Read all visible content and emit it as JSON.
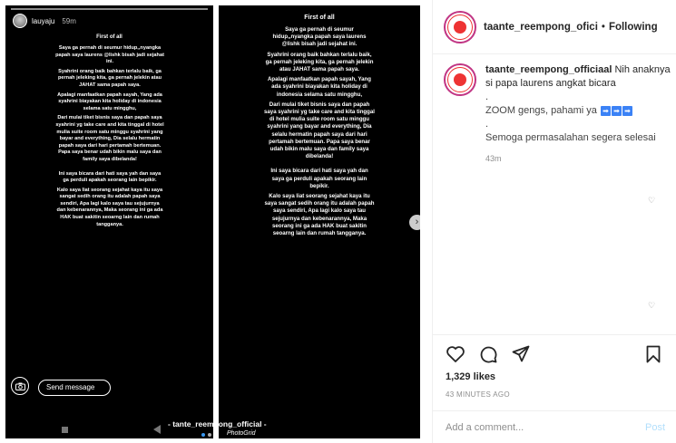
{
  "story_left": {
    "username": "lauyaju",
    "time": "59m",
    "heading": "First of all",
    "paragraphs": [
      "Saya ga pernah di seumur hidup,,nyangka papah saya laurens @lishk bisah jadi sejahat ini.",
      "Syahrini orang baik bahkan terlalu baik, ga pernah jeleking kita, ga pernah jelekin atau JAHAT sama papah saya.",
      "Apalagi manfaatkan papah sayah, Yang ada syahrini biayakan kita holiday di indonesia selama satu mingghu,",
      "Dari mulai tiket bisnis saya dan papah saya syahrini yg take care and kita tinggal di hotel mulia suite room satu minggu syahrini yang bayar and everything, Dia selalu hermatin papah saya dari hari pertamah bertemuan. Papa saya benar udah bikin malu saya dan family saya dibelanda!",
      "Ini saya bicara dari hati saya yah dan saya ga perduli apakah seorang lain bepikir.",
      "Kalo saya liat seorang sejahat kaya itu saya sangat sedih orang itu adalah papah saya sendiri, Apa lagi kalo saya tau sejujurnya dan kebenarannya, Maka seorang ini ga ada HAK buat sakitin seoarng lain dan rumah tangganya."
    ],
    "send_message_placeholder": "Send message",
    "camera_icon": "camera-icon"
  },
  "story_right": {
    "heading": "First of all",
    "paragraphs": [
      "Saya ga pernah di seumur hidup,,nyangka papah saya laurens @lishk bisah jadi sejahat ini.",
      "Syahrini orang baik bahkan terlalu baik, ga pernah jeleking kita, ga pernah jelekin atau JAHAT sama papah saya.",
      "Apalagi manfaatkan papah sayah, Yang ada syahrini biayakan kita holiday di indonesia selama satu mingghu,",
      "Dari mulai tiket bisnis saya dan papah saya syahrini yg take care and kita tinggal di hotel mulia suite room satu minggu syahrini yang bayar and everything, Dia selalu hermatin papah saya dari hari pertamah bertemuan. Papa saya benar udah bikin malu saya dan family saya dibelanda!",
      "Ini saya bicara dari hati saya yah dan saya ga perduli apakah seorang lain bepikir.",
      "Kalo saya liat seorang sejahat kaya itu saya sangat sedih orang itu adalah papah saya sendiri, Apa lagi kalo saya tau sejujurnya dan kebenarannya, Maka seorang ini ga ada HAK buat sakitin seoarng lain dan rumah tangganya."
    ]
  },
  "watermark": {
    "text": "- tante_reempong_official -",
    "sub": "PhotoGrid"
  },
  "carousel": {
    "count": 2,
    "active": 0
  },
  "header": {
    "username": "taante_reempong_ofici",
    "separator": "•",
    "follow_status": "Following"
  },
  "caption": {
    "username": "taante_reempong_officiaal",
    "line1": "Nih anaknya si papa laurens angkat bicara",
    "line2": ".",
    "line3": "ZOOM gengs, pahami ya",
    "line3_icons": [
      "➡",
      "➡",
      "➡"
    ],
    "line4": ".",
    "line5": "Semoga permasalahan segera selesai",
    "time": "43m"
  },
  "post": {
    "likes": "1,329 likes",
    "timestamp": "43 MINUTES AGO",
    "comment_placeholder": "Add a comment...",
    "post_label": "Post"
  },
  "colors": {
    "accent_blue": "#3897f0",
    "post_disabled": "#b2dffc",
    "brand_ring": "#c13584"
  }
}
